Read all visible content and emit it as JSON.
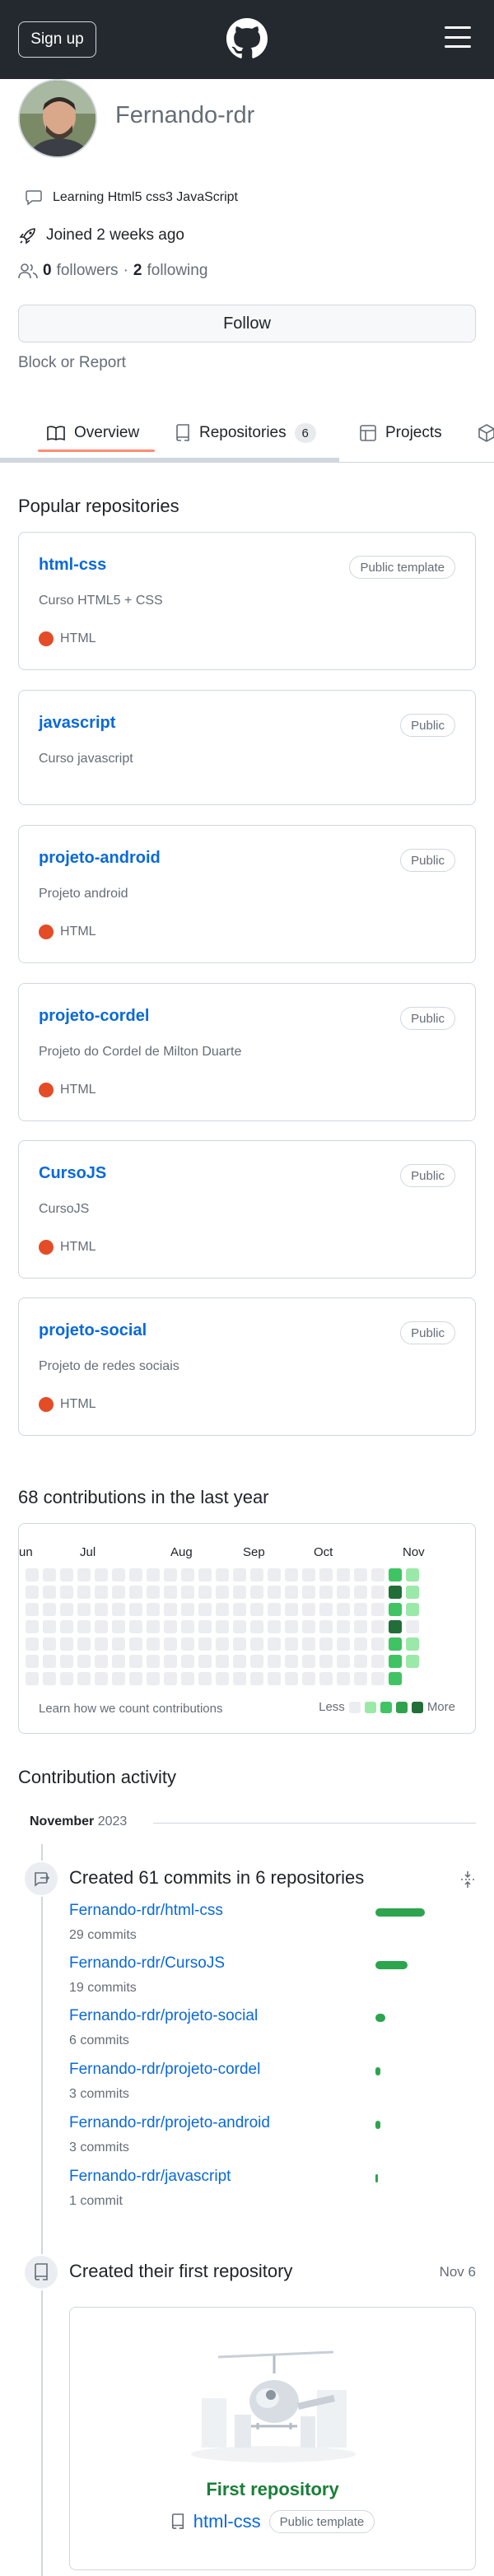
{
  "header": {
    "signup_label": "Sign up",
    "logo_icon": "github-logo-icon",
    "menu_icon": "hamburger-menu-icon",
    "bg_color": "#24292f"
  },
  "profile": {
    "username": "Fernando-rdr",
    "status_text": "Learning Html5 css3 JavaScript",
    "joined": "Joined 2 weeks ago",
    "followers_count": "0",
    "followers_label": "followers",
    "separator": "·",
    "following_count": "2",
    "following_label": "following",
    "follow_label": "Follow",
    "block_label": "Block or Report"
  },
  "tabs": [
    {
      "label": "Overview",
      "active": true
    },
    {
      "label": "Repositories",
      "count": "6"
    },
    {
      "label": "Projects"
    }
  ],
  "popular": {
    "title": "Popular repositories",
    "repos": [
      {
        "name": "html-css",
        "badge": "Public template",
        "desc": "Curso HTML5 + CSS",
        "lang": "HTML"
      },
      {
        "name": "javascript",
        "badge": "Public",
        "desc": "Curso javascript",
        "lang": ""
      },
      {
        "name": "projeto-android",
        "badge": "Public",
        "desc": "Projeto android",
        "lang": "HTML"
      },
      {
        "name": "projeto-cordel",
        "badge": "Public",
        "desc": "Projeto do Cordel de Milton Duarte",
        "lang": "HTML"
      },
      {
        "name": "CursoJS",
        "badge": "Public",
        "desc": "CursoJS",
        "lang": "HTML"
      },
      {
        "name": "projeto-social",
        "badge": "Public",
        "desc": "Projeto de redes sociais",
        "lang": "HTML"
      }
    ]
  },
  "contributions": {
    "title": "68 contributions in the last year",
    "months": [
      "un",
      "Jul",
      "Aug",
      "Sep",
      "Oct",
      "Nov"
    ],
    "learn_link": "Learn how we count contributions",
    "legend_less": "Less",
    "legend_more": "More",
    "colors": [
      "#ebedf0",
      "#9be9a8",
      "#40c463",
      "#30a14e",
      "#216e39"
    ],
    "last_week": [
      2,
      4,
      2,
      4,
      2,
      2,
      2
    ],
    "current_week": [
      1,
      1,
      1,
      0,
      1,
      1
    ]
  },
  "activity": {
    "title": "Contribution activity",
    "month": "November",
    "year": "2023",
    "commits_title": "Created 61 commits in 6 repositories",
    "commit_items": [
      {
        "repo": "Fernando-rdr/html-css",
        "count": "29 commits",
        "n": 29
      },
      {
        "repo": "Fernando-rdr/CursoJS",
        "count": "19 commits",
        "n": 19
      },
      {
        "repo": "Fernando-rdr/projeto-social",
        "count": "6 commits",
        "n": 6
      },
      {
        "repo": "Fernando-rdr/projeto-cordel",
        "count": "3 commits",
        "n": 3
      },
      {
        "repo": "Fernando-rdr/projeto-android",
        "count": "3 commits",
        "n": 3
      },
      {
        "repo": "Fernando-rdr/javascript",
        "count": "1 commit",
        "n": 1
      }
    ],
    "first_repo_title": "Created their first repository",
    "first_repo_date": "Nov 6",
    "first_repo_heading": "First repository",
    "first_repo_name": "html-css",
    "first_repo_badge": "Public template"
  }
}
